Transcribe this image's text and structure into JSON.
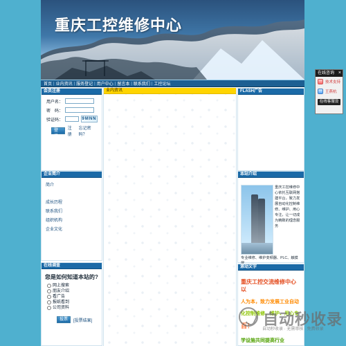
{
  "header": {
    "site_title": "重庆工控维修中心"
  },
  "nav": {
    "items": [
      "首页",
      "业内资讯",
      "服务登记",
      "用户中心",
      "留言本",
      "联系我们",
      "工控论坛"
    ],
    "separator": "|"
  },
  "left": {
    "login": {
      "title": "会员注册",
      "username_label": "用户名：",
      "password_label": "密　码：",
      "captcha_label": "验证码：",
      "captcha_value": "9MNN",
      "login_button": "登录",
      "register_link": "注册",
      "forgot_link": "忘记密码？"
    },
    "company_intro": {
      "title": "企业简介",
      "items": [
        "简介",
        "成长历程",
        "联系我们",
        "组织机构",
        "企业文化"
      ]
    },
    "poll": {
      "title": "在线调查",
      "question": "您是如何知道本站的?",
      "options": [
        "网上搜索",
        "朋友介绍",
        "看广告",
        "报纸看到",
        "公司资料"
      ],
      "vote_button": "投票",
      "results_link": "[投票结果]"
    }
  },
  "middle": {
    "news": {
      "title": "业内资讯"
    }
  },
  "right": {
    "flash": {
      "title": "FLASH广告"
    },
    "site_intro": {
      "title": "本站介绍",
      "text": "重庆工控维修中心依托互联网搭建平台，致力发展自动化控制维修、维护、用心专注，让一切成为精致的理念服务",
      "footer": "专业维修、维护变频器、PLC、触摸屏、"
    },
    "scroll_text": {
      "title": "滚动文字",
      "lines": [
        "重庆工控交流维修中心以",
        "人为本，致力发展工业自动",
        "化控制维修、维护、用心专",
        "百！",
        "学设施共同提高行业"
      ]
    }
  },
  "widget": {
    "title": "在线咨询",
    "close": "×",
    "items": [
      "技术支持",
      "王燕杭"
    ],
    "footer": "在线客服设"
  },
  "watermark": {
    "title": "自动秒收录",
    "subtitle": "自动秒收录 · 无需审核 · 免费收录"
  },
  "colors": {
    "background": "#4fb0cf",
    "nav": "#1d5f92",
    "panel_title": "#1b6aa7",
    "news_title": "#ffd400"
  }
}
